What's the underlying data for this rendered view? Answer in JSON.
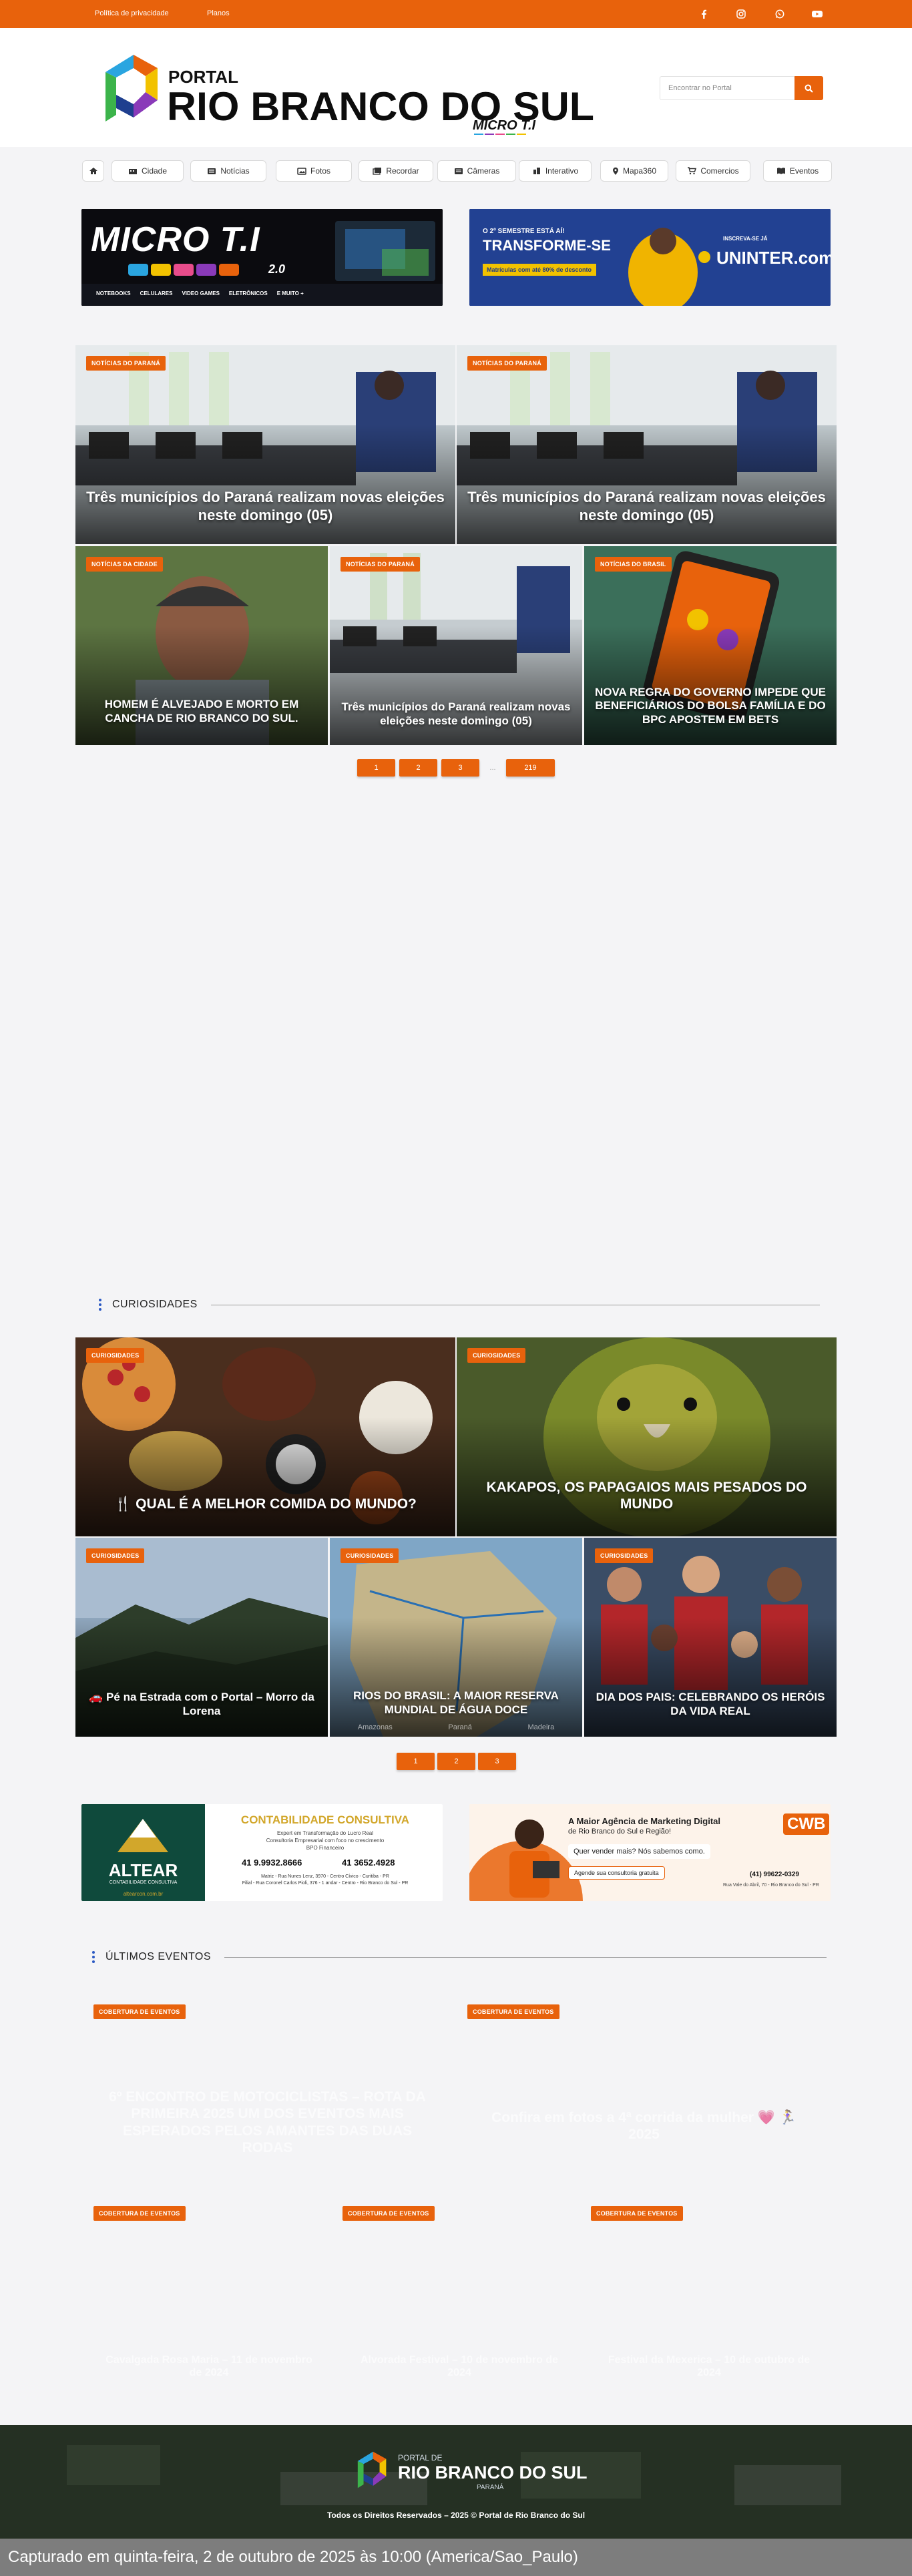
{
  "topbar": {
    "links": [
      "Política de privacidade",
      "Planos"
    ],
    "social": [
      "facebook-icon",
      "instagram-icon",
      "whatsapp-icon",
      "youtube-icon"
    ]
  },
  "header": {
    "logo_top": "PORTAL",
    "logo_main": "RIO BRANCO DO SUL",
    "logo_sponsor": "MICRO T.I",
    "logo_sponsor_sub": "2.0",
    "search_placeholder": "Encontrar no Portal"
  },
  "nav": [
    "Cidade",
    "Notícias",
    "Fotos",
    "Recordar",
    "Câmeras",
    "Interativo",
    "Mapa360",
    "Comercios",
    "Eventos"
  ],
  "ads_top": {
    "left": {
      "brand": "MICRO T.I",
      "version": "2.0",
      "items": [
        "NOTEBOOKS",
        "CELULARES",
        "VIDEO GAMES",
        "ELETRÔNICOS",
        "E MUITO +"
      ]
    },
    "right": {
      "headline_1": "O 2º SEMESTRE ESTÁ AÍ!",
      "headline_2": "TRANSFORME-SE",
      "promo": "Matrículas com até 80% de desconto",
      "cta": "INSCREVA-SE JÁ",
      "brand": "UNINTER.com"
    }
  },
  "featured": [
    {
      "category": "NOTÍCIAS DO PARANÁ",
      "title": "Três municípios do Paraná realizam novas eleições neste domingo (05)"
    },
    {
      "category": "NOTÍCIAS DO PARANÁ",
      "title": "Três municípios do Paraná realizam novas eleições neste domingo (05)"
    },
    {
      "category": "NOTÍCIAS DA CIDADE",
      "title": "HOMEM É ALVEJADO E MORTO EM CANCHA DE RIO BRANCO DO SUL."
    },
    {
      "category": "NOTÍCIAS DO PARANÁ",
      "title": "Três municípios do Paraná realizam novas eleições neste domingo (05)"
    },
    {
      "category": "NOTÍCIAS DO BRASIL",
      "title": "NOVA REGRA DO GOVERNO IMPEDE QUE BENEFICIÁRIOS DO BOLSA FAMÍLIA E DO BPC APOSTEM EM BETS"
    }
  ],
  "pagination_1": [
    "1",
    "2",
    "3",
    "...",
    "219"
  ],
  "curiosidades": {
    "title": "CURIOSIDADES",
    "items": [
      {
        "category": "CURIOSIDADES",
        "title": "🍴 QUAL É A MELHOR COMIDA DO MUNDO?"
      },
      {
        "category": "CURIOSIDADES",
        "title": "KAKAPOS, OS PAPAGAIOS MAIS PESADOS DO MUNDO"
      },
      {
        "category": "CURIOSIDADES",
        "title": "🚗 Pé na Estrada com o Portal – Morro da Lorena"
      },
      {
        "category": "CURIOSIDADES",
        "title": "RIOS DO BRASIL: A MAIOR RESERVA MUNDIAL DE ÁGUA DOCE"
      },
      {
        "category": "CURIOSIDADES",
        "title": "DIA DOS PAIS: CELEBRANDO OS HERÓIS DA VIDA REAL"
      }
    ],
    "map_labels": [
      "Amazonas",
      "Paraná",
      "Madeira"
    ],
    "pagination": [
      "1",
      "2",
      "3"
    ]
  },
  "ads_mid": {
    "left": {
      "brand": "ALTEAR",
      "brand_sub": "CONTABILIDADE CONSULTIVA",
      "website": "altearcon.com.br",
      "headline": "CONTABILIDADE CONSULTIVA",
      "line_1": "Expert em Transformação do Lucro Real",
      "line_2": "Consultoria Empresarial com foco no crescimento",
      "line_3": "BPO Financeiro",
      "phone_1": "41 9.9932.8666",
      "phone_2": "41 3652.4928",
      "address_1": "Matriz - Rua Nunes Lenz, 3970 - Centro Cívico - Curitiba - PR",
      "address_2": "Filial - Rua Coronel Carlos Pioli, 376 - 1 andar - Centro - Rio Branco do Sul - PR"
    },
    "right": {
      "headline": "A Maior Agência de Marketing Digital",
      "subline": "de Rio Branco do Sul e Região!",
      "question": "Quer vender mais? Nós sabemos como.",
      "cta": "Agende sua consultoria gratuita",
      "brand": "CWB",
      "phone": "(41) 99622-0329",
      "address": "Rua Vale do Abril, 70 - Rio Branco do Sul - PR"
    }
  },
  "eventos": {
    "title": "ÚLTIMOS EVENTOS",
    "items": [
      {
        "category": "COBERTURA DE EVENTOS",
        "title": "6º ENCONTRO DE MOTOCICLISTAS – ROTA DA PRIMEIRA 2025 UM DOS EVENTOS MAIS ESPERADOS PELOS AMANTES DAS DUAS RODAS"
      },
      {
        "category": "COBERTURA DE EVENTOS",
        "title": "Confira em fotos a 4ª corrida da mulher 💗 🏃‍♀️ 2025"
      },
      {
        "category": "COBERTURA DE EVENTOS",
        "title": "Cavalgada Rosa Maria – 11 de novembro de 2024"
      },
      {
        "category": "COBERTURA DE EVENTOS",
        "title": "Alvorada Festival – 10 de novembro de 2024"
      },
      {
        "category": "COBERTURA DE EVENTOS",
        "title": "Festival da Mexerica – 10 de outubro de 2024"
      }
    ]
  },
  "footer": {
    "logo_top": "PORTAL DE",
    "logo_main": "RIO BRANCO DO SUL",
    "logo_sub": "PARANÁ",
    "copyright": "Todos os Direitos Reservados – 2025 © Portal de Rio Branco do Sul"
  },
  "capture_text": "Capturado em quinta-feira, 2 de outubro de 2025 às 10:00 (America/Sao_Paulo)",
  "colors": {
    "accent": "#e8620c",
    "nav_text": "#333333",
    "dot_blue": "#2b59c3"
  }
}
